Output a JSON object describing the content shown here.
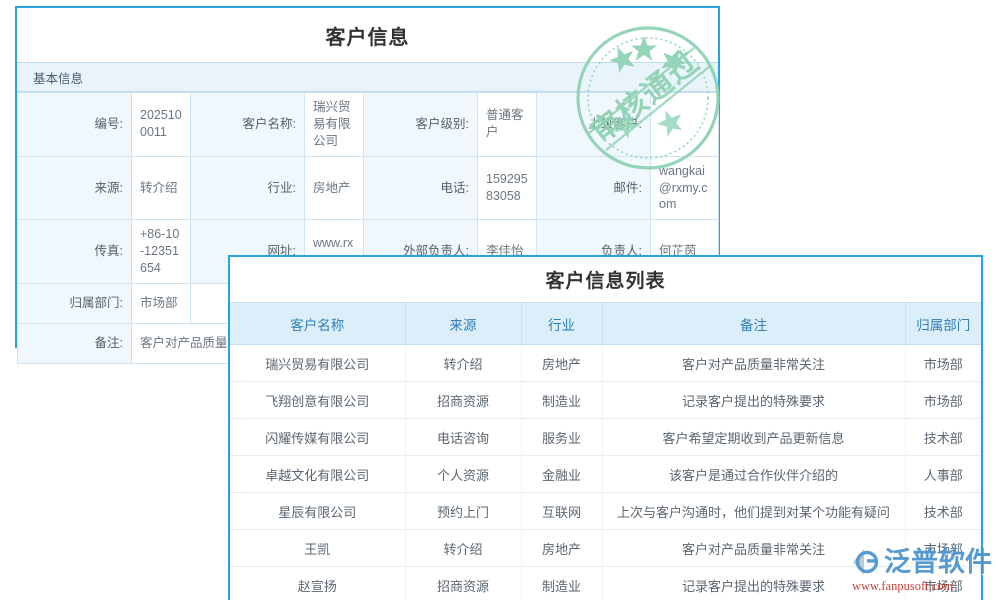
{
  "detail": {
    "title": "客户信息",
    "section_label": "基本信息",
    "rows": [
      [
        {
          "label": "编号:",
          "value": "2025100011"
        },
        {
          "label": "客户名称:",
          "value": "瑞兴贸易有限公司"
        },
        {
          "label": "客户级别:",
          "value": "普通客户"
        },
        {
          "label": "上级客户:",
          "value": ""
        }
      ],
      [
        {
          "label": "来源:",
          "value": "转介绍"
        },
        {
          "label": "行业:",
          "value": "房地产"
        },
        {
          "label": "电话:",
          "value": "15929583058"
        },
        {
          "label": "邮件:",
          "value": "wangkai@rxmy.com"
        }
      ],
      [
        {
          "label": "传真:",
          "value": "+86-10-12351654"
        },
        {
          "label": "网址:",
          "value": "www.rxm"
        },
        {
          "label": "外部负责人:",
          "value": "李佳怡"
        },
        {
          "label": "负责人:",
          "value": "何芷茵"
        }
      ],
      [
        {
          "label": "归属部门:",
          "value": "市场部"
        },
        {
          "label": "",
          "value": ""
        },
        {
          "label": "",
          "value": ""
        },
        {
          "label": "",
          "value": ""
        }
      ],
      [
        {
          "label": "备注:",
          "value": "客户对产品质量非"
        },
        {
          "label": "",
          "value": ""
        },
        {
          "label": "",
          "value": ""
        },
        {
          "label": "",
          "value": ""
        }
      ]
    ]
  },
  "stamp": {
    "text": "审核通过",
    "color": "#8fd3b4"
  },
  "list": {
    "title": "客户信息列表",
    "columns": [
      "客户名称",
      "来源",
      "行业",
      "备注",
      "归属部门"
    ],
    "rows": [
      {
        "name": "瑞兴贸易有限公司",
        "source": "转介绍",
        "industry": "房地产",
        "note": "客户对产品质量非常关注",
        "dept": "市场部"
      },
      {
        "name": "飞翔创意有限公司",
        "source": "招商资源",
        "industry": "制造业",
        "note": "记录客户提出的特殊要求",
        "dept": "市场部"
      },
      {
        "name": "闪耀传媒有限公司",
        "source": "电话咨询",
        "industry": "服务业",
        "note": "客户希望定期收到产品更新信息",
        "dept": "技术部"
      },
      {
        "name": "卓越文化有限公司",
        "source": "个人资源",
        "industry": "金融业",
        "note": "该客户是通过合作伙伴介绍的",
        "dept": "人事部"
      },
      {
        "name": "星辰有限公司",
        "source": "预约上门",
        "industry": "互联网",
        "note": "上次与客户沟通时，他们提到对某个功能有疑问",
        "dept": "技术部"
      },
      {
        "name": "王凯",
        "source": "转介绍",
        "industry": "房地产",
        "note": "客户对产品质量非常关注",
        "dept": "市场部"
      },
      {
        "name": "赵宣扬",
        "source": "招商资源",
        "industry": "制造业",
        "note": "记录客户提出的特殊要求",
        "dept": "市场部"
      }
    ]
  },
  "brand": {
    "name": "泛普软件",
    "url": "www.fanpusoft.com",
    "accent": "#4a93cf"
  },
  "theme": {
    "panel_border": "#29a3e0",
    "header_bg": "#ddeefb",
    "header_text": "#2f7fb5",
    "dept_link": "#3a90d4"
  }
}
